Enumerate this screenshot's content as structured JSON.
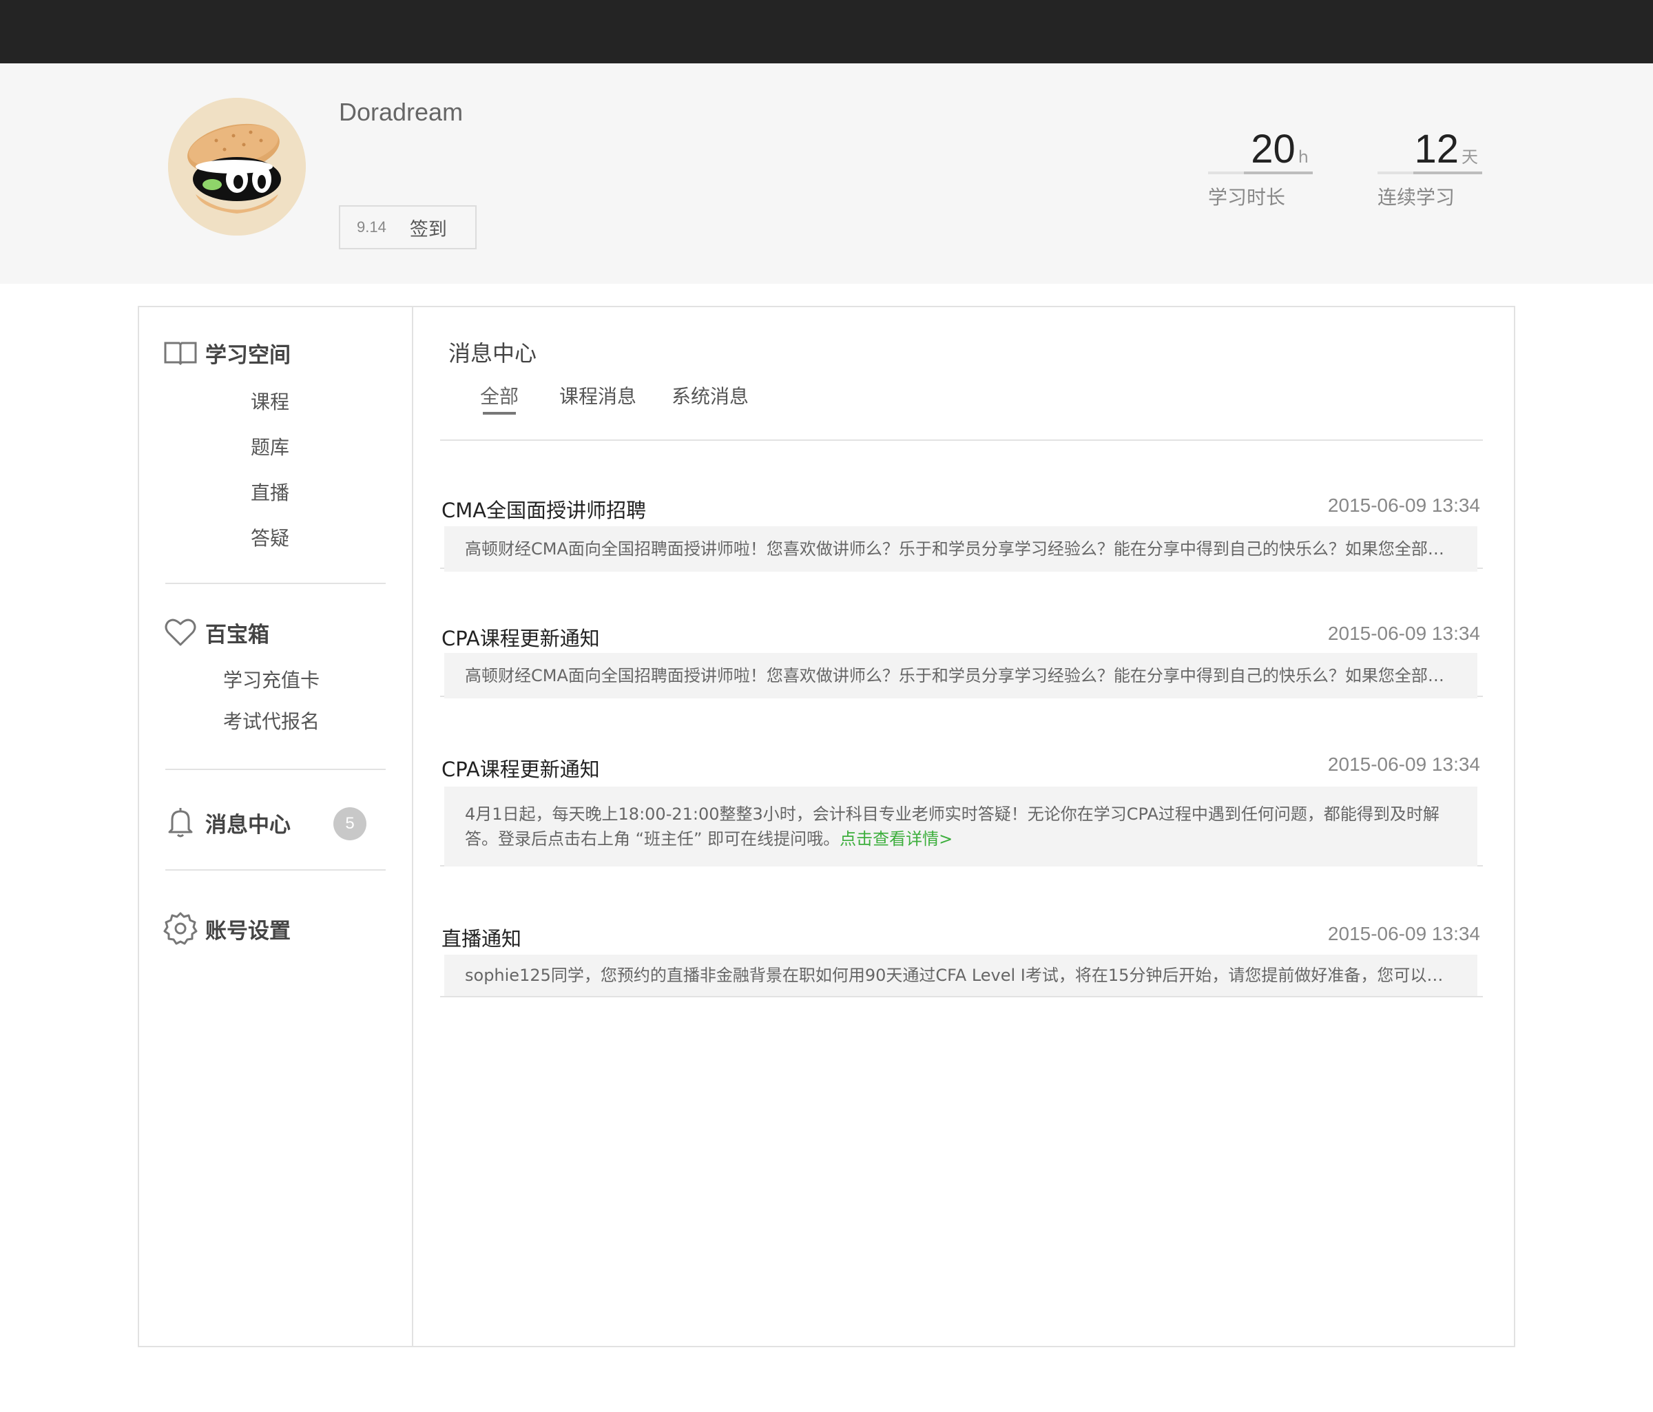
{
  "user": {
    "name": "Doradream",
    "checkin_date": "9.14",
    "checkin_label": "签到"
  },
  "stats": [
    {
      "value": "20",
      "unit": "h",
      "label": "学习时长"
    },
    {
      "value": "12",
      "unit": "天",
      "label": "连续学习"
    }
  ],
  "sidebar": {
    "study_space": {
      "title": "学习空间",
      "items": [
        "课程",
        "题库",
        "直播",
        "答疑"
      ]
    },
    "toolbox": {
      "title": "百宝箱",
      "items": [
        "学习充值卡",
        "考试代报名"
      ]
    },
    "messages": {
      "title": "消息中心",
      "badge": "5"
    },
    "settings": {
      "title": "账号设置"
    }
  },
  "main": {
    "title": "消息中心",
    "tabs": [
      "全部",
      "课程消息",
      "系统消息"
    ],
    "active_tab": "全部",
    "messages": [
      {
        "title": "CMA全国面授讲师招聘",
        "time": "2015-06-09 13:34",
        "body": "高顿财经CMA面向全国招聘面授讲师啦！您喜欢做讲师么？乐于和学员分享学习经验么？能在分享中得到自己的快乐么？如果您全部符..."
      },
      {
        "title": "CPA课程更新通知",
        "time": "2015-06-09 13:34",
        "body": "高顿财经CMA面向全国招聘面授讲师啦！您喜欢做讲师么？乐于和学员分享学习经验么？能在分享中得到自己的快乐么？如果您全部符..."
      },
      {
        "title": "CPA课程更新通知",
        "time": "2015-06-09 13:34",
        "body": "4月1日起，每天晚上18:00-21:00整整3小时，会计科目专业老师实时答疑！无论你在学习CPA过程中遇到任何问题，都能得到及时解答。登录后点击右上角 “班主任” 即可在线提问哦。",
        "link": "点击查看详情>"
      },
      {
        "title": "直播通知",
        "time": "2015-06-09 13:34",
        "body": "sophie125同学，您预约的直播非金融背景在职如何用90天通过CFA Level I考试，将在15分钟后开始，请您提前做好准备，您可以提前..."
      }
    ]
  },
  "colors": {
    "topbar": "#242424",
    "link": "#3cae3c",
    "badge": "#c8c8c8"
  }
}
